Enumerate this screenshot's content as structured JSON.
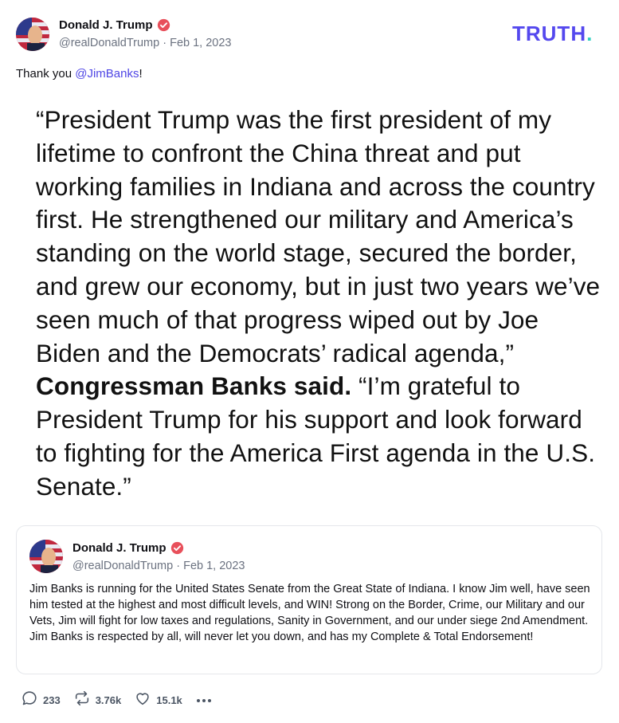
{
  "post": {
    "author": {
      "display_name": "Donald J. Trump",
      "handle": "@realDonaldTrump",
      "separator": " · ",
      "date": "Feb 1, 2023"
    },
    "logo": {
      "text": "TRUTH",
      "dot": "."
    },
    "body": {
      "prefix": "Thank you ",
      "mention": "@JimBanks",
      "suffix": "!"
    },
    "quote_image": {
      "part1": "“President Trump was the first president of my lifetime to confront the China threat and put working families in Indiana and across the country first. He strengthened our military and America’s standing on the world stage, secured the border, and grew our economy, but in just two years we’ve seen much of that progress wiped out by Joe Biden and the Democrats’ radical agenda,” ",
      "bold": "Congressman Banks said.",
      "part2": " “I’m grateful to President Trump for his support and look forward to fighting for the America First agenda in the U.S. Senate.”"
    },
    "embedded": {
      "author": {
        "display_name": "Donald J. Trump",
        "handle": "@realDonaldTrump",
        "separator": " · ",
        "date": "Feb 1, 2023"
      },
      "text": "Jim Banks is running for the United States Senate from the Great State of Indiana. I know Jim well, have seen him tested at the highest and most difficult levels, and WIN! Strong on the Border, Crime, our Military and our Vets, Jim will fight for low taxes and regulations, Sanity in Government, and our under siege 2nd Amendment. Jim Banks is respected by all, will never let you down, and has my Complete & Total Endorsement!"
    },
    "actions": {
      "replies": "233",
      "retruths": "3.76k",
      "likes": "15.1k"
    }
  },
  "icons": {
    "verified": "verified-badge-icon",
    "reply": "comment-icon",
    "retruth": "repost-icon",
    "like": "heart-icon",
    "more": "more-dots-icon"
  },
  "colors": {
    "brand": "#5448ee",
    "brand_dot": "#2fd0c0",
    "mention": "#4f46e5",
    "verified": "#e8505b"
  }
}
